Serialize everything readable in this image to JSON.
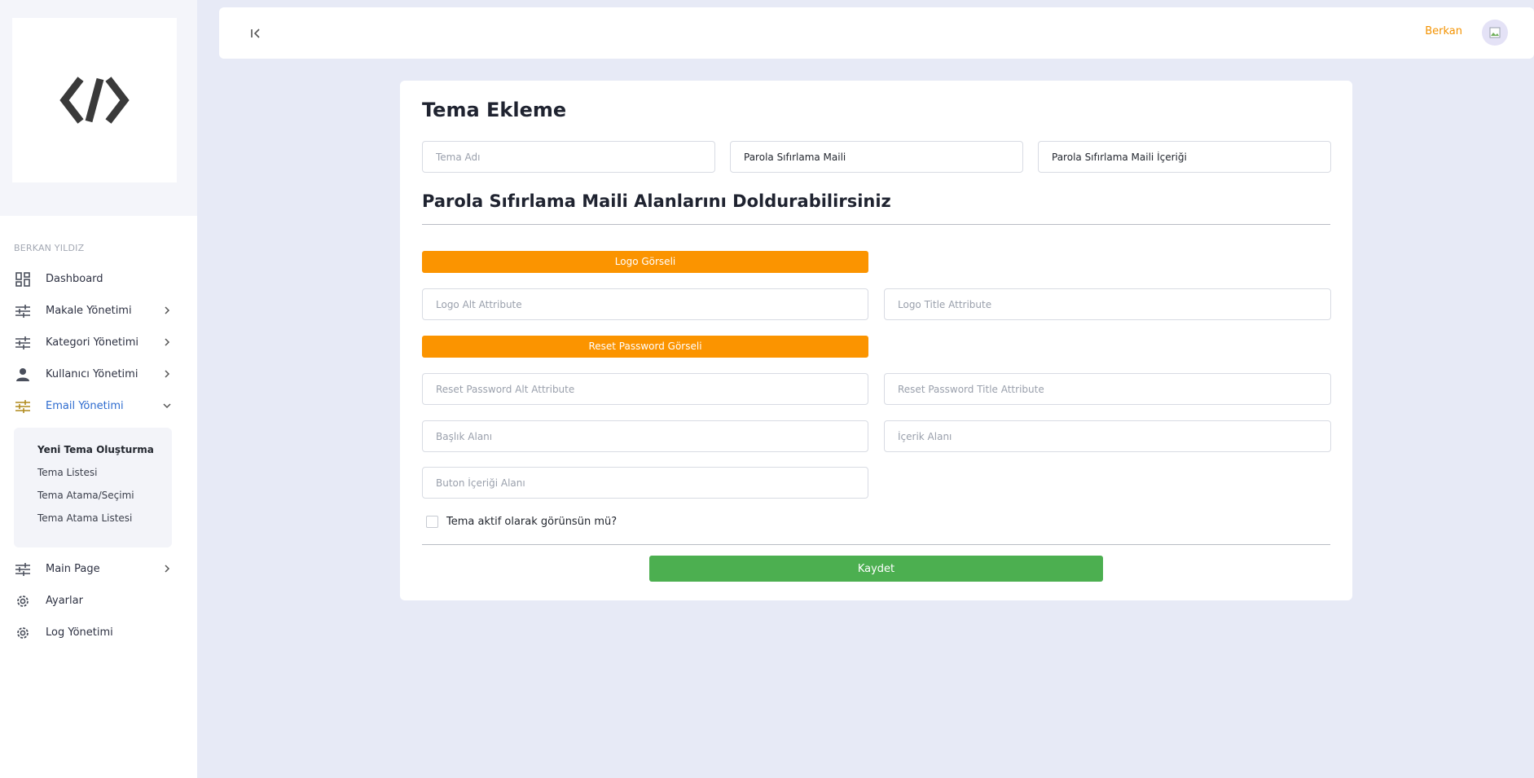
{
  "sidebar": {
    "user_section_title": "BERKAN YILDIZ",
    "items": [
      {
        "label": "Dashboard",
        "icon": "dashboard-icon"
      },
      {
        "label": "Makale Yönetimi",
        "icon": "tune-icon"
      },
      {
        "label": "Kategori Yönetimi",
        "icon": "tune-icon"
      },
      {
        "label": "Kullanıcı Yönetimi",
        "icon": "person-icon"
      },
      {
        "label": "Email Yönetimi",
        "icon": "tune-icon"
      }
    ],
    "submenu": [
      {
        "label": "Yeni Tema Oluşturma"
      },
      {
        "label": "Tema Listesi"
      },
      {
        "label": "Tema Atama/Seçimi"
      },
      {
        "label": "Tema Atama Listesi"
      }
    ],
    "items2": [
      {
        "label": "Main Page",
        "icon": "tune-icon"
      },
      {
        "label": "Ayarlar",
        "icon": "gear-icon"
      },
      {
        "label": "Log Yönetimi",
        "icon": "gear-icon"
      }
    ]
  },
  "topbar": {
    "user_name": "Berkan"
  },
  "form": {
    "title": "Tema Ekleme",
    "theme_name_placeholder": "Tema Adı",
    "mail_type_value": "Parola Sıfırlama Maili",
    "mail_content_value": "Parola Sıfırlama Maili İçeriği",
    "section_title": "Parola Sıfırlama Maili Alanlarını Doldurabilirsiniz",
    "logo_image_button": "Logo Görseli",
    "logo_alt_placeholder": "Logo Alt Attribute",
    "logo_title_placeholder": "Logo Title Attribute",
    "reset_image_button": "Reset Password Görseli",
    "reset_alt_placeholder": "Reset Password Alt Attribute",
    "reset_title_placeholder": "Reset Password Title Attribute",
    "heading_placeholder": "Başlık Alanı",
    "content_placeholder": "İçerik Alanı",
    "button_content_placeholder": "Buton İçeriği Alanı",
    "active_checkbox_label": "Tema aktif olarak görünsün mü?",
    "save_button": "Kaydet"
  },
  "colors": {
    "accent_orange": "#fb9400",
    "save_green": "#4caf50",
    "active_blue": "#2d6bcf",
    "background": "#e7eaf6"
  }
}
